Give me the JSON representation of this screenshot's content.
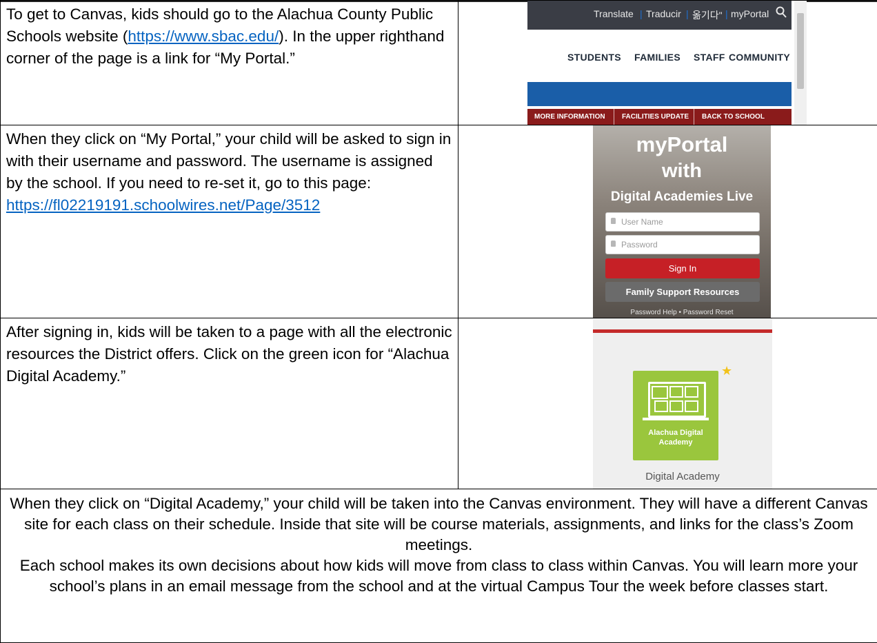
{
  "rows": [
    {
      "text_before": "To get to Canvas, kids should go to the Alachua County Public Schools website (",
      "link": "https://www.sbac.edu/",
      "text_after": "). In the upper righthand corner of the page is a link for “My Portal.”"
    },
    {
      "text": "When they click on “My Portal,” your child will be asked to sign in with their username and password. The username is assigned by the school. If you need to re-set it, go to this page:",
      "link": "https://fl02219191.schoolwires.net/Page/3512"
    },
    {
      "text": "After signing in, kids will be taken to a page with all the electronic resources the District offers. Click on the green icon for “Alachua Digital Academy.”"
    }
  ],
  "bottom": {
    "paragraph1": "When they click on “Digital Academy,” your child will be taken into the Canvas environment. They will have a different Canvas site for each class on their schedule. Inside that site will be course materials, assignments, and links for the class’s Zoom meetings.",
    "paragraph2": "Each school makes its own decisions about how kids will move from class to class within Canvas. You will learn more your school’s plans in an email message from the school and at the virtual Campus Tour the week before classes start."
  },
  "sbac_screenshot": {
    "topbar": {
      "translate": "Translate",
      "traducir": "Traducir",
      "korean": "옮기다\"",
      "myportal": "myPortal",
      "search_icon": "magnifier-icon"
    },
    "nav": [
      "STUDENTS",
      "FAMILIES",
      "STAFF",
      "COMMUNITY"
    ],
    "buttons": [
      "MORE INFORMATION",
      "FACILITIES UPDATE",
      "BACK TO SCHOOL"
    ],
    "colors": {
      "topbar": "#3a3d45",
      "blue_band": "#1a5ea8",
      "red_band": "#8a1b1b"
    }
  },
  "portal_screenshot": {
    "title1": "myPortal",
    "title2": "with",
    "title3": "Digital Academies Live",
    "username_placeholder": "User Name",
    "password_placeholder": "Password",
    "sign_in": "Sign In",
    "family_support": "Family Support Resources",
    "password_help": "Password Help",
    "bullet": "•",
    "password_reset": "Password Reset",
    "colors": {
      "sign_in": "#c62026",
      "family_support": "#6b6b6b"
    }
  },
  "academy_screenshot": {
    "tile_line1": "Alachua Digital",
    "tile_line2": "Academy",
    "label": "Digital Academy",
    "colors": {
      "tile": "#9ac63d",
      "star": "#f2c21b",
      "accent_line": "#c42a2a"
    }
  }
}
